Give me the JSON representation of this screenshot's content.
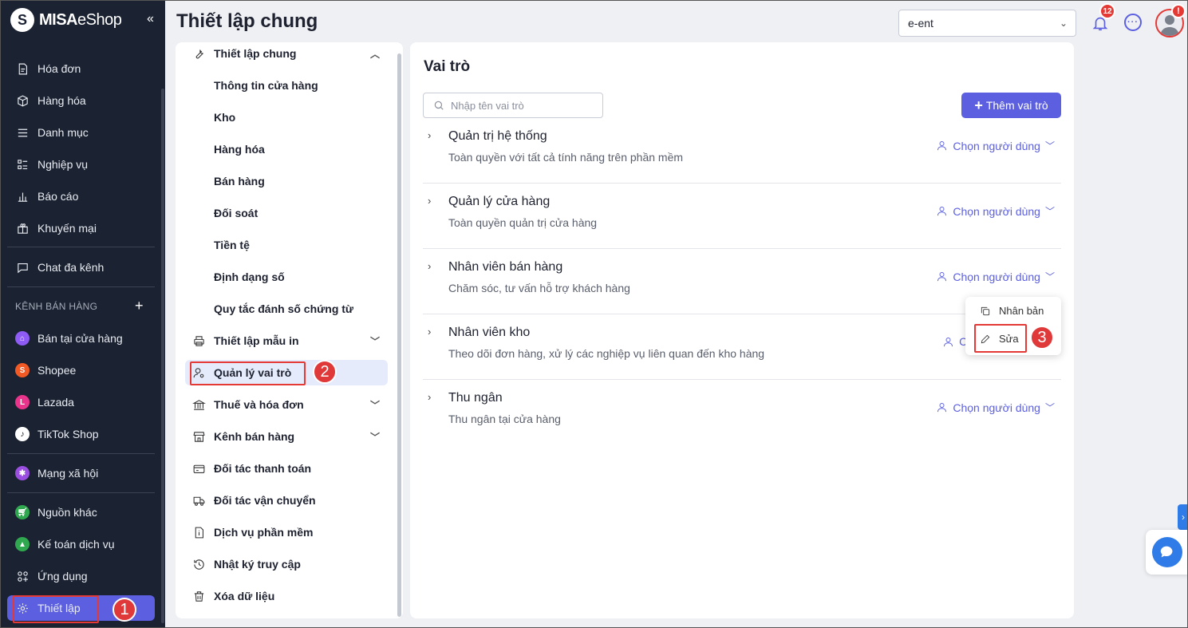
{
  "app": {
    "logo_misa": "MISA",
    "logo_eshop": "eShop",
    "collapse_icon": "chevrons-left"
  },
  "sidebar": {
    "items": [
      {
        "label": "Hóa đơn",
        "icon": "invoice-icon"
      },
      {
        "label": "Hàng hóa",
        "icon": "box-icon"
      },
      {
        "label": "Danh mục",
        "icon": "list-icon"
      },
      {
        "label": "Nghiệp vụ",
        "icon": "tasks-icon"
      },
      {
        "label": "Báo cáo",
        "icon": "chart-icon"
      },
      {
        "label": "Khuyến mại",
        "icon": "gift-icon"
      },
      {
        "label": "Chat đa kênh",
        "icon": "chat-icon"
      }
    ],
    "section_title": "KÊNH BÁN HÀNG",
    "channels": [
      {
        "label": "Bán tại cửa hàng",
        "color": "#8e5cf5"
      },
      {
        "label": "Shopee",
        "color": "#f15a24"
      },
      {
        "label": "Lazada",
        "color": "#e9348b"
      },
      {
        "label": "TikTok Shop",
        "color": "#111111"
      }
    ],
    "social": {
      "label": "Mạng xã hội",
      "color": "#9b4fe0"
    },
    "other": [
      {
        "label": "Nguồn khác",
        "color": "#2fa84f"
      },
      {
        "label": "Kế toán dịch vụ",
        "color": "#2fa84f"
      },
      {
        "label": "Ứng dụng",
        "icon": "apps-icon"
      }
    ],
    "settings": {
      "label": "Thiết lập",
      "icon": "gear-icon"
    }
  },
  "header": {
    "title": "Thiết lập chung",
    "store_select": "e-ent",
    "notification_count": "12",
    "avatar_badge": "!"
  },
  "settings_menu": {
    "general": "Thiết lập chung",
    "general_sub": [
      "Thông tin cửa hàng",
      "Kho",
      "Hàng hóa",
      "Bán hàng",
      "Đối soát",
      "Tiền tệ",
      "Định dạng số",
      "Quy tắc đánh số chứng từ"
    ],
    "print_templates": "Thiết lập mẫu in",
    "roles": "Quản lý vai trò",
    "tax_invoice": "Thuế và hóa đơn",
    "sales_channels": "Kênh bán hàng",
    "payment_partners": "Đối tác thanh toán",
    "shipping_partners": "Đối tác vận chuyển",
    "software_services": "Dịch vụ phần mềm",
    "access_log": "Nhật ký truy cập",
    "delete_data": "Xóa dữ liệu"
  },
  "roles_page": {
    "title": "Vai trò",
    "search_placeholder": "Nhập tên vai trò",
    "add_button": "Thêm vai trò",
    "select_user_label": "Chọn người dùng",
    "roles": [
      {
        "name": "Quản trị hệ thống",
        "desc": "Toàn quyền với tất cả tính năng trên phần mềm"
      },
      {
        "name": "Quản lý cửa hàng",
        "desc": "Toàn quyền quản trị cửa hàng"
      },
      {
        "name": "Nhân viên bán hàng",
        "desc": "Chăm sóc, tư vấn hỗ trợ khách hàng"
      },
      {
        "name": "Nhân viên kho",
        "desc": "Theo dõi đơn hàng, xử lý các nghiệp vụ liên quan đến kho hàng"
      },
      {
        "name": "Thu ngân",
        "desc": "Thu ngân tại cửa hàng"
      }
    ],
    "partial_user_label": "Ch",
    "menu": {
      "duplicate": "Nhân bản",
      "edit": "Sửa"
    }
  },
  "steps": [
    "1",
    "2",
    "3"
  ],
  "colors": {
    "accent": "#5b5fe0",
    "sidebar_bg": "#1b2231",
    "annotation": "#e53935"
  }
}
